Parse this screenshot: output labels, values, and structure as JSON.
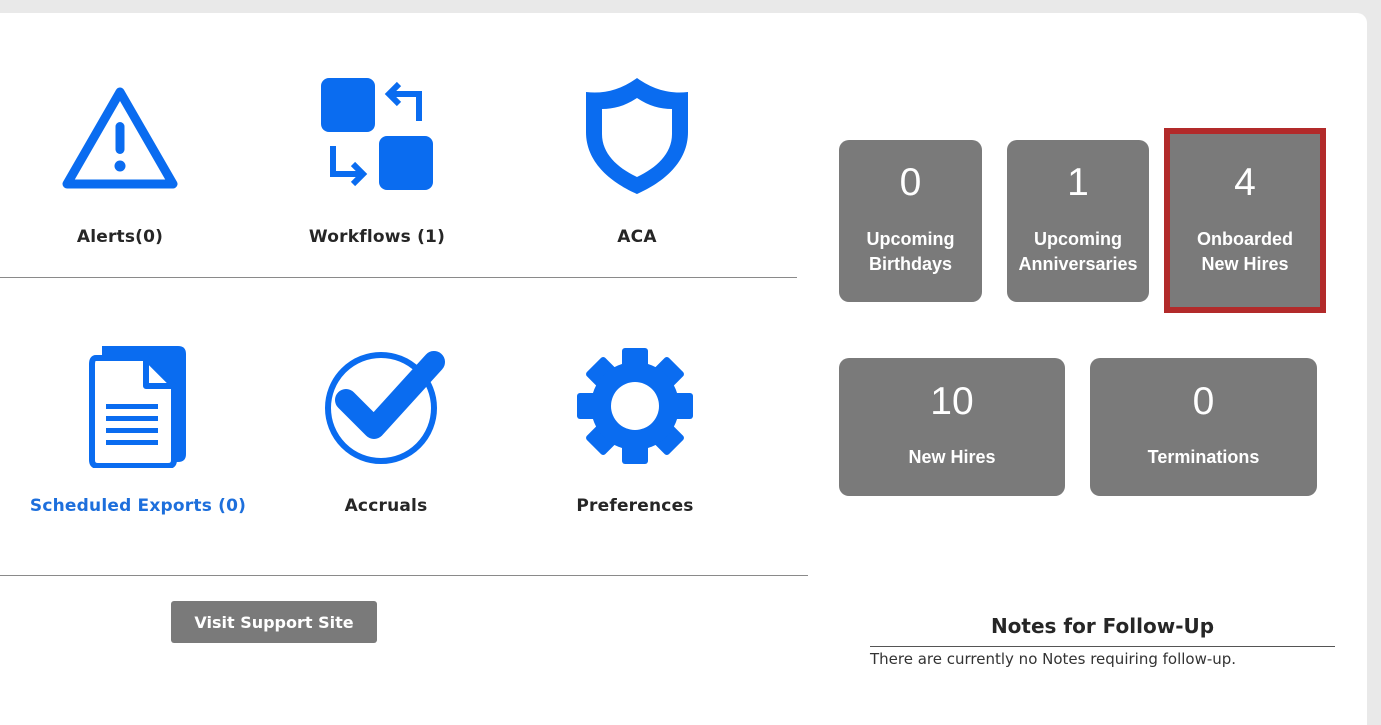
{
  "tiles": {
    "alerts": {
      "label": "Alerts(0)",
      "icon": "warning-triangle-icon"
    },
    "workflows": {
      "label": "Workflows (1)",
      "icon": "workflow-swap-icon"
    },
    "aca": {
      "label": "ACA",
      "icon": "shield-icon"
    },
    "scheduled_exports": {
      "label": "Scheduled Exports (0)",
      "icon": "documents-icon"
    },
    "accruals": {
      "label": "Accruals",
      "icon": "check-circle-icon"
    },
    "preferences": {
      "label": "Preferences",
      "icon": "gear-icon"
    }
  },
  "support": {
    "label": "Visit Support Site"
  },
  "stats": {
    "upcoming_birthdays": {
      "count": "0",
      "line1": "Upcoming",
      "line2": "Birthdays"
    },
    "upcoming_anniversaries": {
      "count": "1",
      "line1": "Upcoming",
      "line2": "Anniversaries"
    },
    "onboarded_new_hires": {
      "count": "4",
      "line1": "Onboarded",
      "line2": "New Hires"
    },
    "new_hires": {
      "count": "10",
      "line1": "New Hires"
    },
    "terminations": {
      "count": "0",
      "line1": "Terminations"
    }
  },
  "notes": {
    "title": "Notes for Follow-Up",
    "empty_text": "There are currently no Notes requiring follow-up."
  },
  "colors": {
    "icon_blue": "#0a6cf0",
    "link_blue": "#1d6fdc",
    "card_gray": "#7a7a7a",
    "highlight_red": "#b22a2a",
    "page_gray": "#e9e9e9"
  }
}
